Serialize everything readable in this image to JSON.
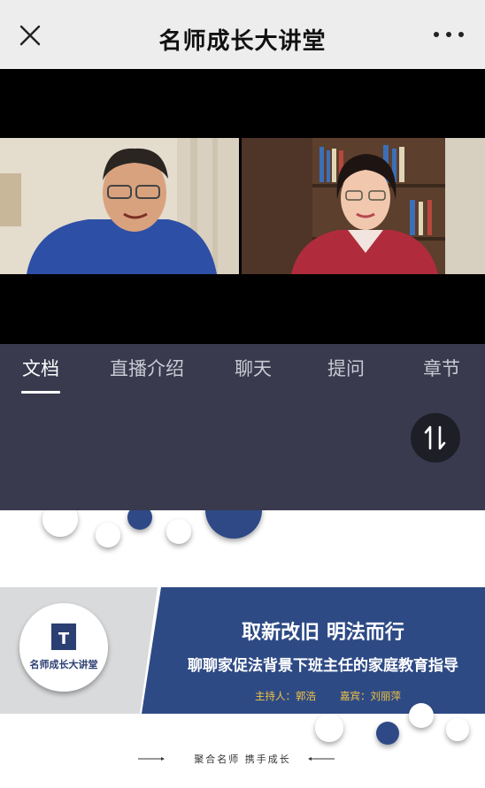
{
  "header": {
    "title": "名师成长大讲堂"
  },
  "tabs": [
    {
      "label": "文档",
      "active": true
    },
    {
      "label": "直播介绍",
      "active": false
    },
    {
      "label": "聊天",
      "active": false
    },
    {
      "label": "提问",
      "active": false
    },
    {
      "label": "章节",
      "active": false
    }
  ],
  "slide": {
    "logo_text": "名师成长大讲堂",
    "logo_letter": "T",
    "headline": "取新改旧 明法而行",
    "subtitle": "聊聊家促法背景下班主任的家庭教育指导",
    "host_label": "主持人：郭浩",
    "guest_label": "嘉宾：刘丽萍",
    "footer_slogan": "聚合名师  携手成长"
  },
  "colors": {
    "tab_bg": "#393a4e",
    "slide_blue": "#2e4a85",
    "host_yellow": "#f4c542"
  }
}
